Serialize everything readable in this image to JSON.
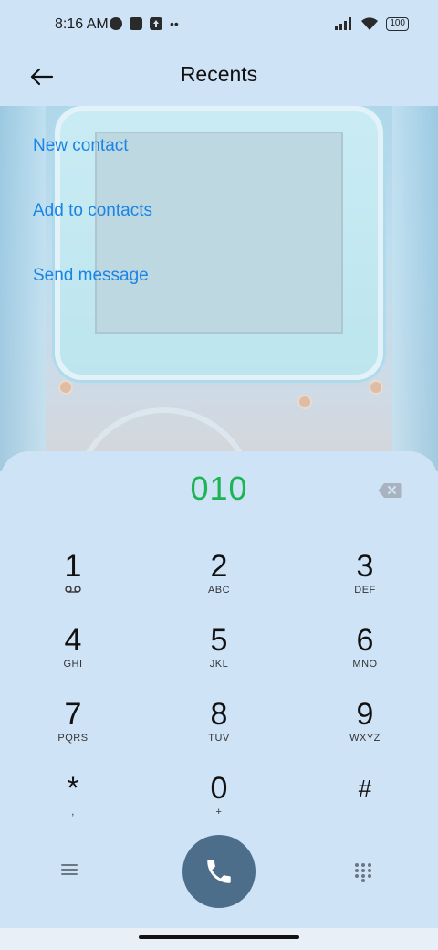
{
  "status_bar": {
    "time": "8:16 AM",
    "battery": "100",
    "icons_left": [
      "settings-app-icon",
      "square-icon",
      "upload-icon",
      "more-dots-icon"
    ],
    "icons_right": [
      "signal-icon",
      "wifi-icon",
      "battery-icon"
    ]
  },
  "header": {
    "title": "Recents",
    "back_icon": "arrow-left-icon"
  },
  "menu": {
    "items": [
      {
        "label": "New contact"
      },
      {
        "label": "Add to contacts"
      },
      {
        "label": "Send message"
      }
    ]
  },
  "dialer": {
    "number": "010",
    "backspace_icon": "backspace-icon",
    "keys": [
      {
        "digit": "1",
        "letters": "",
        "icon": "voicemail-icon"
      },
      {
        "digit": "2",
        "letters": "ABC"
      },
      {
        "digit": "3",
        "letters": "DEF"
      },
      {
        "digit": "4",
        "letters": "GHI"
      },
      {
        "digit": "5",
        "letters": "JKL"
      },
      {
        "digit": "6",
        "letters": "MNO"
      },
      {
        "digit": "7",
        "letters": "PQRS"
      },
      {
        "digit": "8",
        "letters": "TUV"
      },
      {
        "digit": "9",
        "letters": "WXYZ"
      },
      {
        "digit": "*",
        "letters": ","
      },
      {
        "digit": "0",
        "letters": "+"
      },
      {
        "digit": "#",
        "letters": ""
      }
    ],
    "bottom": {
      "menu_icon": "hamburger-menu-icon",
      "call_icon": "phone-icon",
      "keypad_icon": "dialpad-icon"
    }
  },
  "colors": {
    "accent_link": "#1a84e6",
    "number": "#1db553",
    "call_button": "#4c6e8b",
    "background": "#cfe3f6"
  }
}
